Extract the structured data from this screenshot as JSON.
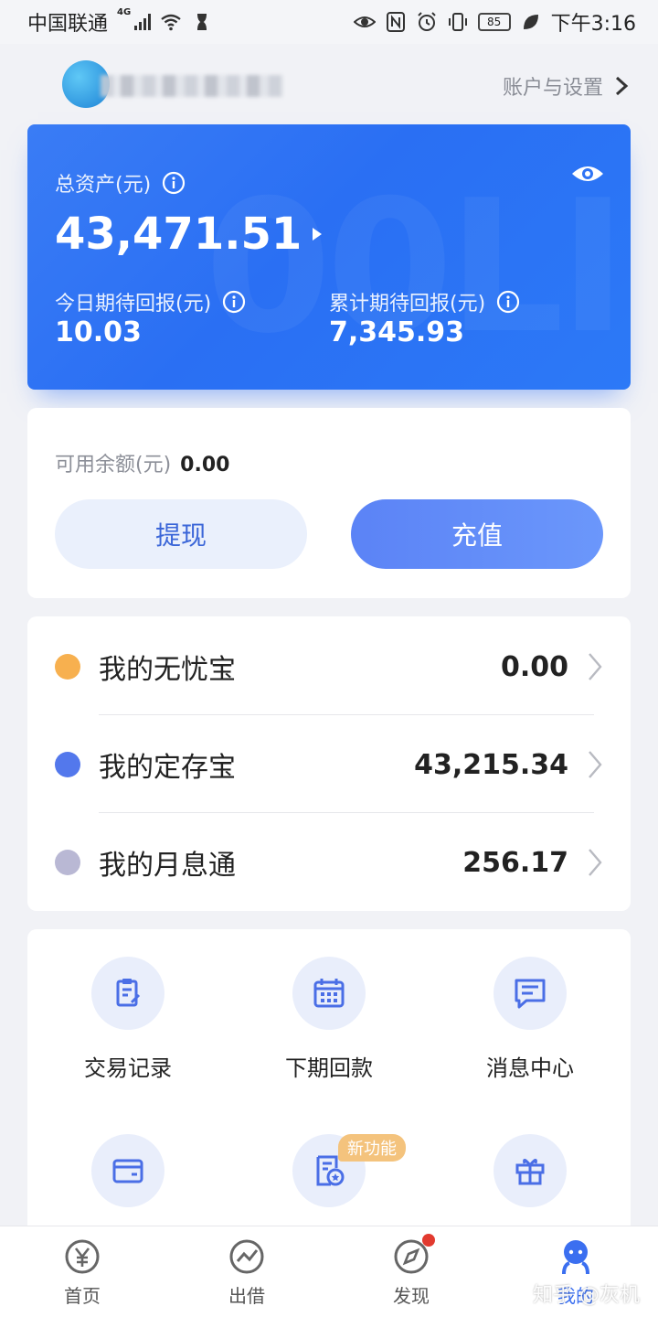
{
  "status_bar": {
    "carrier": "中国联通",
    "network": "4G",
    "battery": "85",
    "time": "下午3:16"
  },
  "header": {
    "account_settings_label": "账户与设置"
  },
  "assets": {
    "total_label": "总资产(元)",
    "total_value": "43,471.51",
    "today_label": "今日期待回报(元)",
    "today_value": "10.03",
    "cumulative_label": "累计期待回报(元)",
    "cumulative_value": "7,345.93"
  },
  "balance": {
    "label": "可用余额(元)",
    "value": "0.00",
    "withdraw_label": "提现",
    "recharge_label": "充值"
  },
  "products": [
    {
      "name": "我的无忧宝",
      "value": "0.00",
      "color": "#f7b04f"
    },
    {
      "name": "我的定存宝",
      "value": "43,215.34",
      "color": "#5378ec"
    },
    {
      "name": "我的月息通",
      "value": "256.17",
      "color": "#b9b8d4"
    }
  ],
  "grid": {
    "items": [
      {
        "label": "交易记录",
        "icon": "clipboard-icon"
      },
      {
        "label": "下期回款",
        "icon": "calendar-icon"
      },
      {
        "label": "消息中心",
        "icon": "message-icon"
      },
      {
        "label": "",
        "icon": "wallet-icon"
      },
      {
        "label": "",
        "icon": "document-star-icon"
      },
      {
        "label": "",
        "icon": "gift-icon"
      }
    ],
    "new_badge": "新功能"
  },
  "tabs": [
    {
      "label": "首页",
      "icon": "yen-icon"
    },
    {
      "label": "出借",
      "icon": "trend-icon"
    },
    {
      "label": "发现",
      "icon": "compass-icon"
    },
    {
      "label": "我的",
      "icon": "user-icon",
      "active": true
    }
  ],
  "watermark": "知乎 @灰机",
  "colors": {
    "card_blue": "#2f74f5",
    "accent": "#3b6ff0",
    "recharge": "#5b83f6"
  }
}
